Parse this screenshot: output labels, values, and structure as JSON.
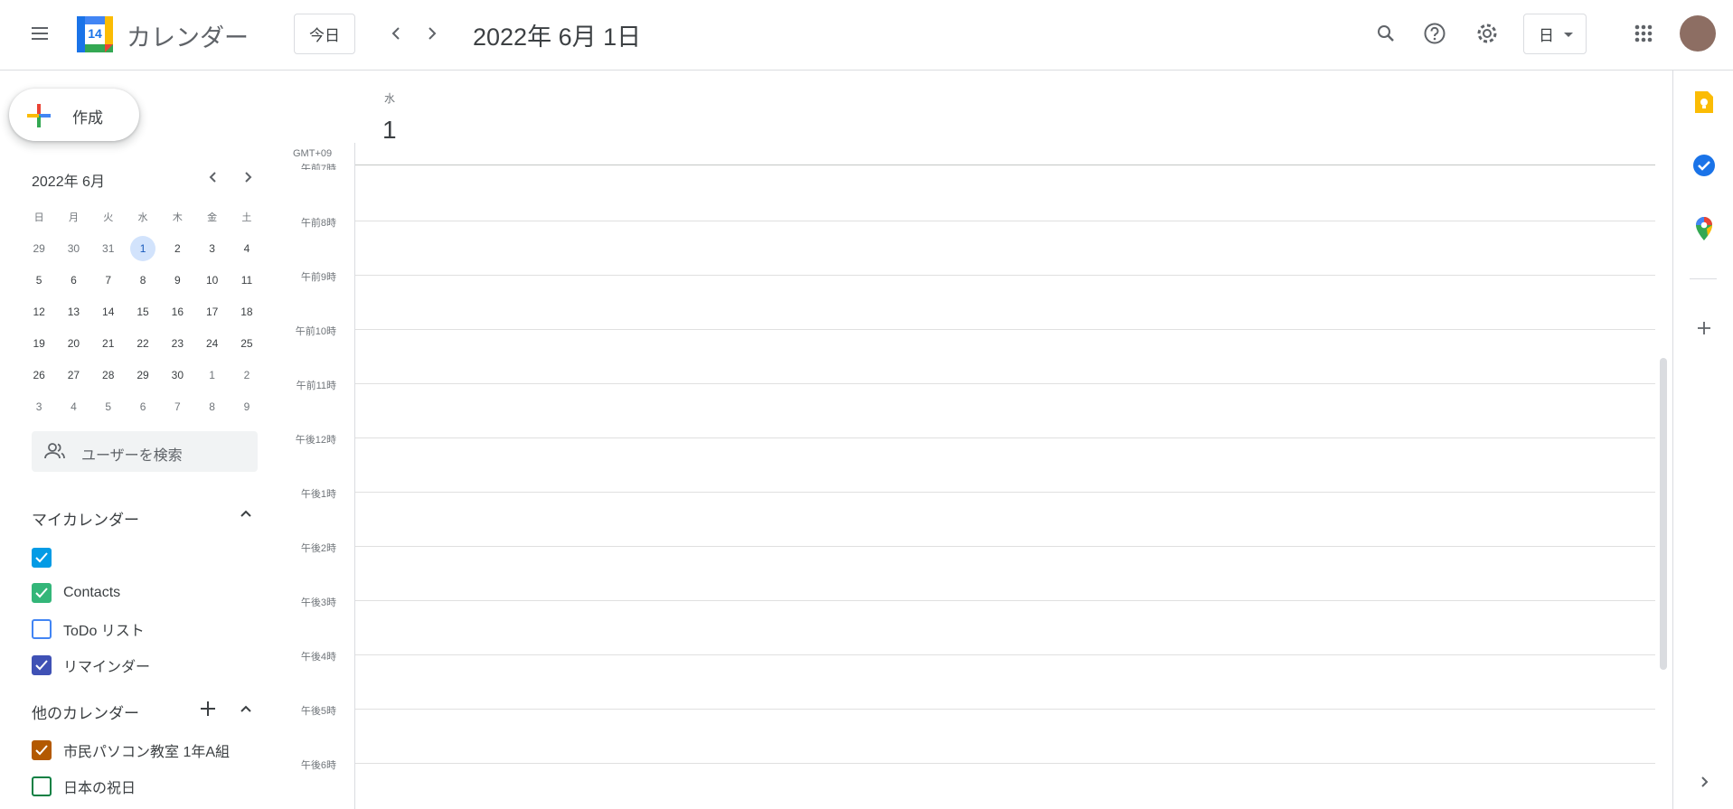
{
  "header": {
    "app_title": "カレンダー",
    "logo_day": "14",
    "today_label": "今日",
    "date_title": "2022年 6月 1日",
    "view_label": "日",
    "icons": [
      "main-menu-icon",
      "prev-icon",
      "next-icon",
      "search-icon",
      "help-icon",
      "settings-icon",
      "apps-grid-icon"
    ]
  },
  "create": {
    "label": "作成"
  },
  "mini_calendar": {
    "title": "2022年 6月",
    "weekdays": [
      "日",
      "月",
      "火",
      "水",
      "木",
      "金",
      "土"
    ],
    "weeks": [
      [
        "29",
        "30",
        "31",
        "1",
        "2",
        "3",
        "4"
      ],
      [
        "5",
        "6",
        "7",
        "8",
        "9",
        "10",
        "11"
      ],
      [
        "12",
        "13",
        "14",
        "15",
        "16",
        "17",
        "18"
      ],
      [
        "19",
        "20",
        "21",
        "22",
        "23",
        "24",
        "25"
      ],
      [
        "26",
        "27",
        "28",
        "29",
        "30",
        "1",
        "2"
      ],
      [
        "3",
        "4",
        "5",
        "6",
        "7",
        "8",
        "9"
      ]
    ],
    "selected": "1"
  },
  "search_users": {
    "placeholder": "ユーザーを検索"
  },
  "my_calendars": {
    "title": "マイカレンダー",
    "items": [
      {
        "label": "",
        "color": "#039be5",
        "checked": true
      },
      {
        "label": "Contacts",
        "color": "#33b679",
        "checked": true
      },
      {
        "label": "ToDo リスト",
        "color": "#4285f4",
        "checked": false
      },
      {
        "label": "リマインダー",
        "color": "#3f51b5",
        "checked": true
      }
    ]
  },
  "other_calendars": {
    "title": "他のカレンダー",
    "items": [
      {
        "label": "市民パソコン教室 1年A組",
        "color": "#b35900",
        "checked": true
      },
      {
        "label": "日本の祝日",
        "color": "#0b8043",
        "checked": false
      }
    ]
  },
  "day_view": {
    "weekday": "水",
    "day_number": "1",
    "timezone": "GMT+09",
    "hours": [
      "午前7時",
      "午前8時",
      "午前9時",
      "午前10時",
      "午前11時",
      "午後12時",
      "午後1時",
      "午後2時",
      "午後3時",
      "午後4時",
      "午後5時",
      "午後6時"
    ]
  },
  "side_panel": {
    "icons": [
      "keep-icon",
      "tasks-icon",
      "maps-icon",
      "add-addon-icon",
      "expand-panel-icon"
    ],
    "colors": {
      "keep": "#fbbc04",
      "tasks": "#1a73e8"
    }
  }
}
